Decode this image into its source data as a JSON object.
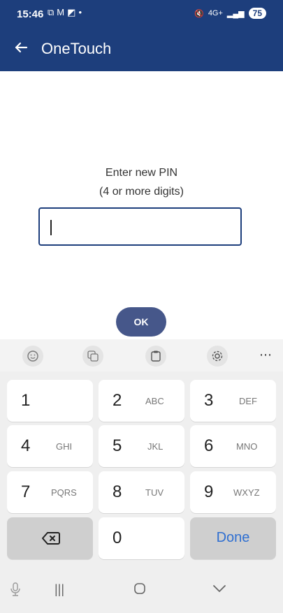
{
  "status": {
    "time": "15:46",
    "left_icons": [
      "screenshot-icon",
      "gmail-icon",
      "app-icon",
      "dot-icon"
    ],
    "right_icons": [
      "mute-icon",
      "network-icon",
      "signal-icon"
    ],
    "network_label": "4G+",
    "battery": "75"
  },
  "app_bar": {
    "title": "OneTouch",
    "back_icon": "back-arrow-icon"
  },
  "form": {
    "prompt_line1": "Enter new PIN",
    "prompt_line2": "(4 or more digits)",
    "pin_value": "",
    "ok_label": "OK"
  },
  "keyboard_toolbar": [
    "emoji-icon",
    "text-style-icon",
    "clipboard-icon",
    "settings-icon",
    "more-icon"
  ],
  "keypad": {
    "rows": [
      [
        {
          "num": "1",
          "letters": ""
        },
        {
          "num": "2",
          "letters": "ABC"
        },
        {
          "num": "3",
          "letters": "DEF"
        }
      ],
      [
        {
          "num": "4",
          "letters": "GHI"
        },
        {
          "num": "5",
          "letters": "JKL"
        },
        {
          "num": "6",
          "letters": "MNO"
        }
      ],
      [
        {
          "num": "7",
          "letters": "PQRS"
        },
        {
          "num": "8",
          "letters": "TUV"
        },
        {
          "num": "9",
          "letters": "WXYZ"
        }
      ]
    ],
    "zero": "0",
    "done": "Done"
  },
  "nav_bar": [
    "microphone-icon",
    "recent-apps-icon",
    "home-icon",
    "collapse-keyboard-icon"
  ],
  "colors": {
    "primary": "#1d3e7c",
    "ok_button": "#46578a",
    "done_text": "#2f6fd1"
  }
}
